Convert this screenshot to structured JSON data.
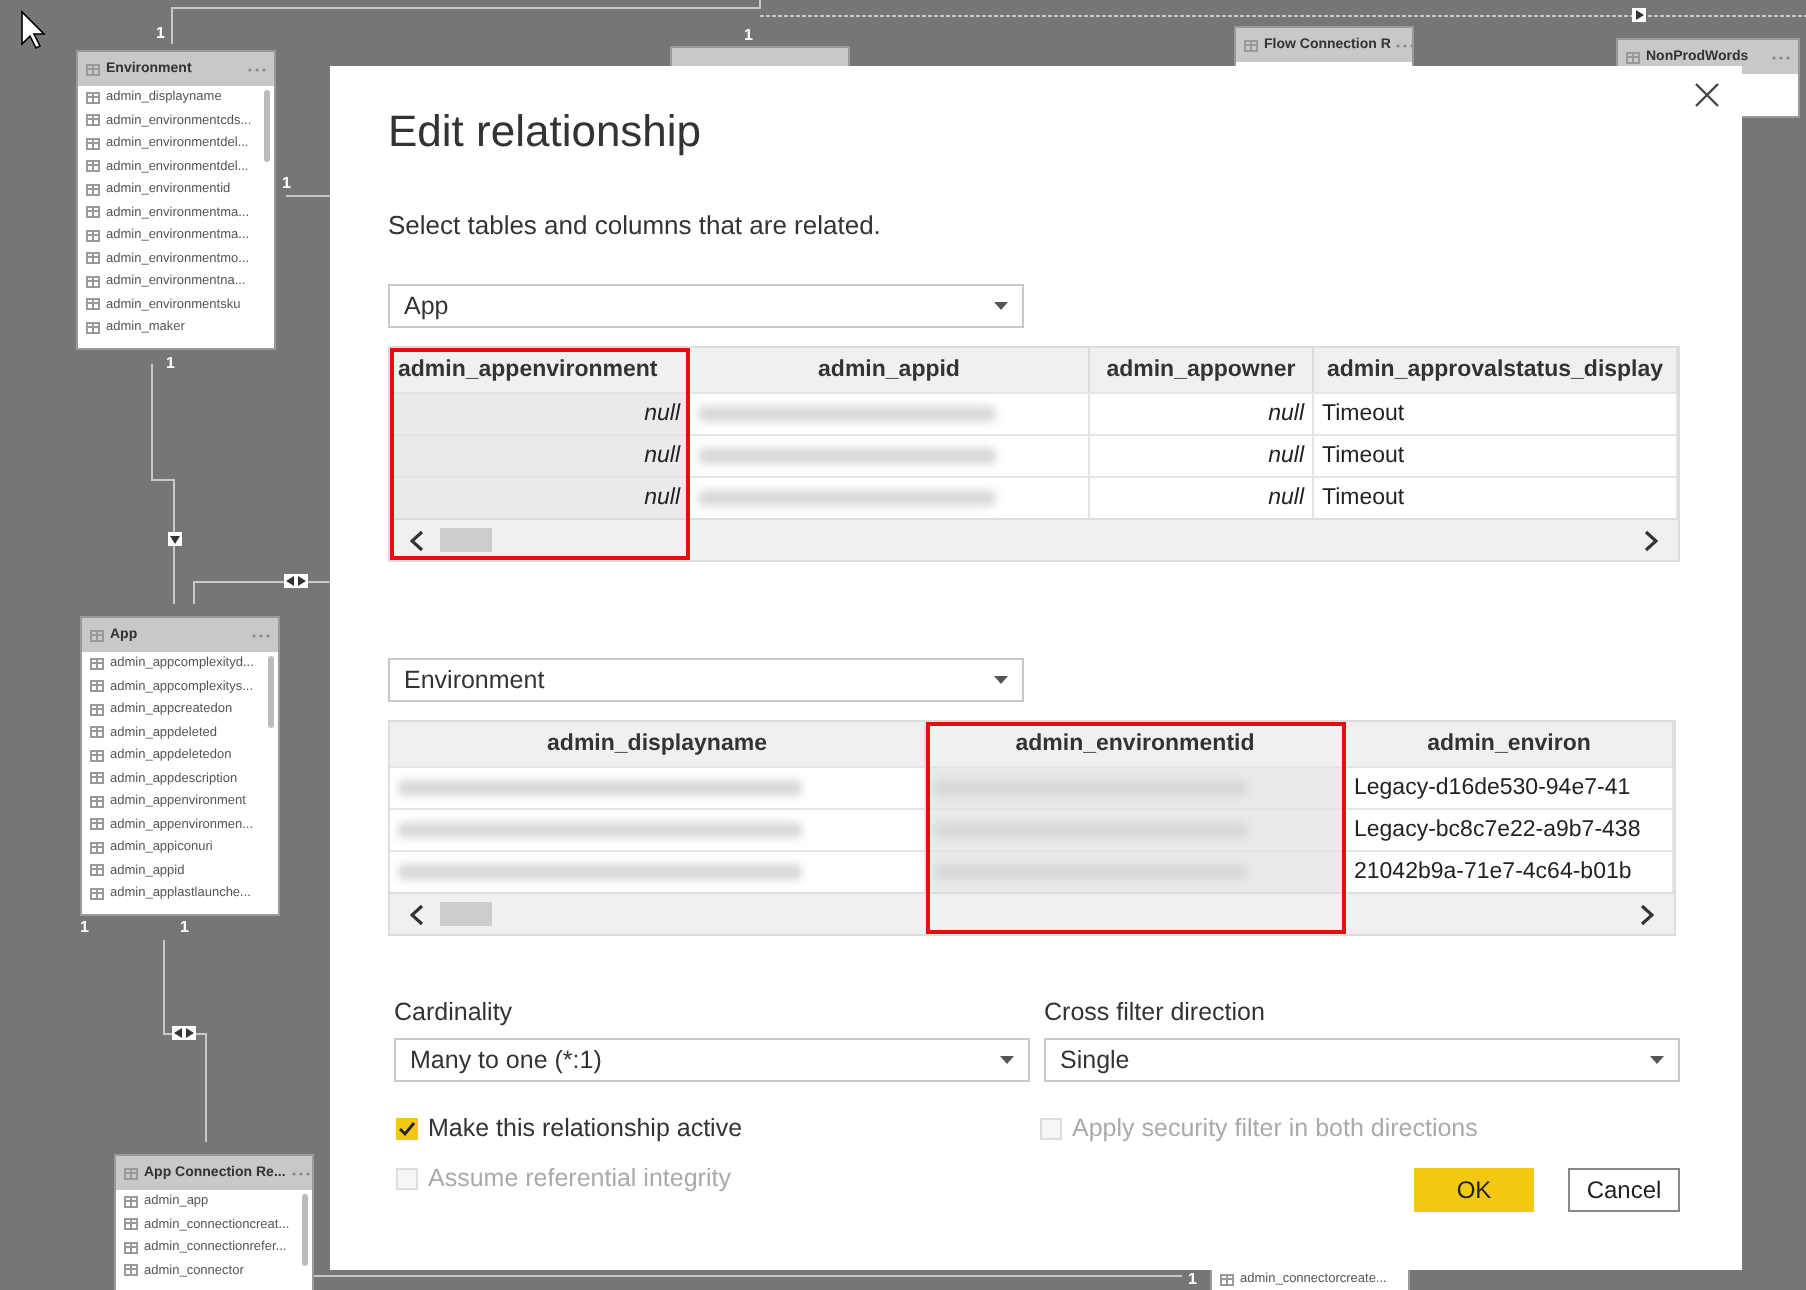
{
  "canvas": {
    "tables": [
      {
        "title": "Environment",
        "fields": [
          "admin_displayname",
          "admin_environmentcds...",
          "admin_environmentdel...",
          "admin_environmentdel...",
          "admin_environmentid",
          "admin_environmentma...",
          "admin_environmentma...",
          "admin_environmentmo...",
          "admin_environmentna...",
          "admin_environmentsku",
          "admin_maker"
        ]
      },
      {
        "title": "Flow Connection R"
      },
      {
        "title": "NonProdWords"
      },
      {
        "title": "App",
        "fields": [
          "admin_appcomplexityd...",
          "admin_appcomplexitys...",
          "admin_appcreatedon",
          "admin_appdeleted",
          "admin_appdeletedon",
          "admin_appdescription",
          "admin_appenvironment",
          "admin_appenvironmen...",
          "admin_appiconuri",
          "admin_appid",
          "admin_applastlaunche..."
        ]
      },
      {
        "title": "App Connection Re...",
        "fields": [
          "admin_app",
          "admin_connectioncreat...",
          "admin_connectionrefer...",
          "admin_connector"
        ]
      },
      {
        "fields": [
          "admin_connectorcreate..."
        ]
      }
    ],
    "cardinality_labels": [
      "1",
      "1",
      "1",
      "1",
      "1",
      "1",
      "1"
    ]
  },
  "dialog": {
    "title": "Edit relationship",
    "subtitle": "Select tables and columns that are related.",
    "tables": [
      {
        "selector": "App",
        "columns": [
          {
            "header": "admin_appenvironment",
            "selected": true
          },
          {
            "header": "admin_appid",
            "selected": false
          },
          {
            "header": "admin_appowner",
            "selected": false
          },
          {
            "header": "admin_approvalstatus_display",
            "selected": false
          }
        ],
        "rows": [
          [
            {
              "kind": "null",
              "text": "null"
            },
            {
              "kind": "redacted"
            },
            {
              "kind": "null",
              "text": "null"
            },
            {
              "kind": "text",
              "text": "Timeout"
            }
          ],
          [
            {
              "kind": "null",
              "text": "null"
            },
            {
              "kind": "redacted"
            },
            {
              "kind": "null",
              "text": "null"
            },
            {
              "kind": "text",
              "text": "Timeout"
            }
          ],
          [
            {
              "kind": "null",
              "text": "null"
            },
            {
              "kind": "redacted"
            },
            {
              "kind": "null",
              "text": "null"
            },
            {
              "kind": "text",
              "text": "Timeout"
            }
          ]
        ]
      },
      {
        "selector": "Environment",
        "columns": [
          {
            "header": "admin_displayname",
            "selected": false
          },
          {
            "header": "admin_environmentid",
            "selected": true
          },
          {
            "header": "admin_environ",
            "selected": false
          }
        ],
        "rows": [
          [
            {
              "kind": "redacted"
            },
            {
              "kind": "redacted"
            },
            {
              "kind": "text",
              "text": "Legacy-d16de530-94e7-41"
            }
          ],
          [
            {
              "kind": "redacted"
            },
            {
              "kind": "redacted"
            },
            {
              "kind": "text",
              "text": "Legacy-bc8c7e22-a9b7-438"
            }
          ],
          [
            {
              "kind": "redacted"
            },
            {
              "kind": "redacted"
            },
            {
              "kind": "text",
              "text": "21042b9a-71e7-4c64-b01b"
            }
          ]
        ]
      }
    ],
    "cardinality": {
      "label": "Cardinality",
      "value": "Many to one (*:1)"
    },
    "cross_filter": {
      "label": "Cross filter direction",
      "value": "Single"
    },
    "options": [
      {
        "label": "Make this relationship active",
        "checked": true,
        "disabled": false
      },
      {
        "label": "Apply security filter in both directions",
        "checked": false,
        "disabled": true
      },
      {
        "label": "Assume referential integrity",
        "checked": false,
        "disabled": true
      }
    ],
    "buttons": [
      {
        "label": "OK",
        "kind": "primary"
      },
      {
        "label": "Cancel",
        "kind": "secondary"
      }
    ]
  }
}
